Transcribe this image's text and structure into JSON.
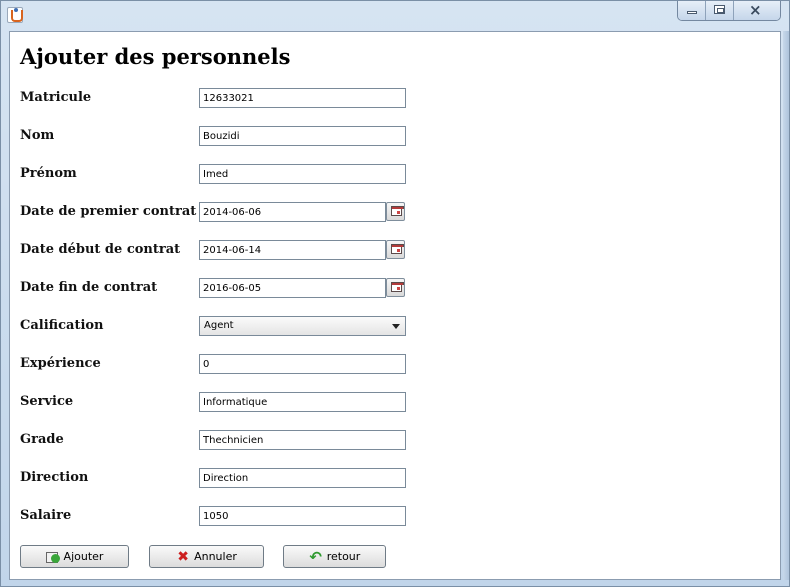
{
  "window": {
    "title": ""
  },
  "form": {
    "title": "Ajouter des personnels",
    "fields": {
      "matricule": {
        "label": "Matricule",
        "value": "12633021"
      },
      "nom": {
        "label": "Nom",
        "value": "Bouzidi"
      },
      "prenom": {
        "label": "Prénom",
        "value": "Imed"
      },
      "date_premier_contrat": {
        "label": "Date de premier contrat",
        "value": "2014-06-06"
      },
      "date_debut_contrat": {
        "label": "Date début de contrat",
        "value": "2014-06-14"
      },
      "date_fin_contrat": {
        "label": "Date fin de contrat",
        "value": "2016-06-05"
      },
      "calification": {
        "label": "Calification",
        "value": "Agent"
      },
      "experience": {
        "label": "Expérience",
        "value": "0"
      },
      "service": {
        "label": "Service",
        "value": "Informatique"
      },
      "grade": {
        "label": "Grade",
        "value": "Thechnicien"
      },
      "direction": {
        "label": "Direction",
        "value": "Direction"
      },
      "salaire": {
        "label": "Salaire",
        "value": "1050"
      }
    }
  },
  "buttons": {
    "ajouter": {
      "label": "Ajouter",
      "icon": "add-document-icon"
    },
    "annuler": {
      "label": "Annuler",
      "icon": "red-x-icon"
    },
    "retour": {
      "label": "retour",
      "icon": "green-back-arrow-icon"
    }
  },
  "colors": {
    "frame": "#c1d5ea",
    "client_bg": "#ffffff",
    "field_border": "#7a8a99",
    "cancel_red": "#cc1e1e",
    "back_green": "#2f9a2f"
  }
}
